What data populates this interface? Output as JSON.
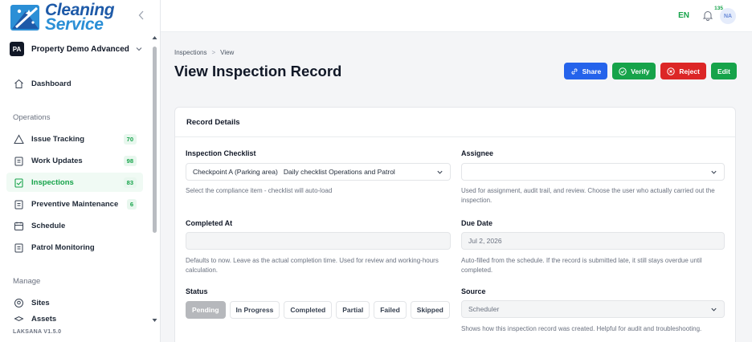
{
  "brand": {
    "line1": "Cleaning",
    "line2": "Service"
  },
  "property": {
    "initials": "PA",
    "name": "Property Demo Advanced"
  },
  "nav": {
    "dashboard": "Dashboard",
    "operations_title": "Operations",
    "issue_tracking": {
      "label": "Issue Tracking",
      "count": "70"
    },
    "work_updates": {
      "label": "Work Updates",
      "count": "98"
    },
    "inspections": {
      "label": "Inspections",
      "count": "83"
    },
    "preventive": {
      "label": "Preventive Maintenance",
      "count": "6"
    },
    "schedule": "Schedule",
    "patrol": "Patrol Monitoring",
    "manage_title": "Manage",
    "sites": "Sites",
    "assets": "Assets"
  },
  "version": "LAKSANA V1.5.0",
  "topbar": {
    "lang": "EN",
    "notifications": "135",
    "avatar": "NA"
  },
  "breadcrumb": {
    "parent": "Inspections",
    "sep": ">",
    "current": "View"
  },
  "page_title": "View Inspection Record",
  "actions": {
    "share": "Share",
    "verify": "Verify",
    "reject": "Reject",
    "edit": "Edit"
  },
  "card": {
    "title": "Record Details",
    "checklist": {
      "label": "Inspection Checklist",
      "value": "Checkpoint A (Parking area)   Daily checklist Operations and Patrol",
      "hint": "Select the compliance item - checklist will auto-load"
    },
    "assignee": {
      "label": "Assignee",
      "value": "",
      "hint": "Used for assignment, audit trail, and review. Choose the user who actually carried out the inspection."
    },
    "completed_at": {
      "label": "Completed At",
      "value": "",
      "hint": "Defaults to now. Leave as the actual completion time. Used for review and working-hours calculation."
    },
    "due_date": {
      "label": "Due Date",
      "value": "Jul 2, 2026",
      "hint": "Auto-filled from the schedule. If the record is submitted late, it still stays overdue until completed."
    },
    "status": {
      "label": "Status",
      "options": [
        "Pending",
        "In Progress",
        "Completed",
        "Partial",
        "Failed",
        "Skipped"
      ],
      "selected": "Pending"
    },
    "source": {
      "label": "Source",
      "value": "Scheduler",
      "hint": "Shows how this inspection record was created. Helpful for audit and troubleshooting."
    }
  },
  "colors": {
    "accent_green": "#16a34a",
    "share_blue": "#2563eb",
    "reject_red": "#dc2626",
    "brand_blue": "#1e5aa8"
  }
}
